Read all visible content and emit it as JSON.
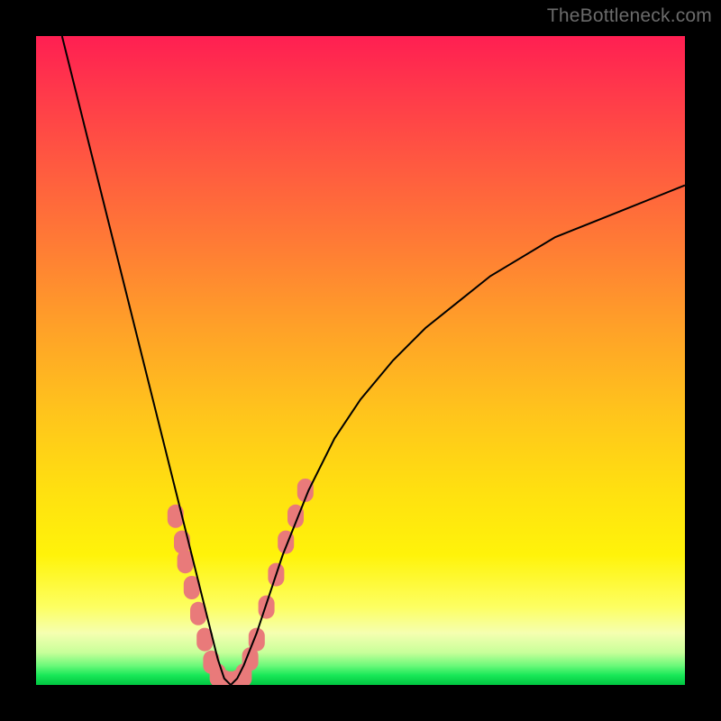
{
  "watermark": {
    "text": "TheBottleneck.com"
  },
  "chart_data": {
    "type": "line",
    "title": "",
    "xlabel": "",
    "ylabel": "",
    "xlim": [
      0,
      100
    ],
    "ylim": [
      0,
      100
    ],
    "grid": false,
    "legend": false,
    "series": [
      {
        "name": "bottleneck-curve",
        "x": [
          4,
          6,
          8,
          10,
          12,
          14,
          16,
          18,
          20,
          22,
          24,
          26,
          27,
          28,
          29,
          30,
          31,
          32,
          34,
          36,
          38,
          42,
          46,
          50,
          55,
          60,
          65,
          70,
          75,
          80,
          85,
          90,
          95,
          100
        ],
        "y": [
          100,
          92,
          84,
          76,
          68,
          60,
          52,
          44,
          36,
          28,
          20,
          12,
          8,
          4,
          1,
          0,
          1,
          3,
          8,
          14,
          20,
          30,
          38,
          44,
          50,
          55,
          59,
          63,
          66,
          69,
          71,
          73,
          75,
          77
        ],
        "color": "#000000",
        "width": 2
      }
    ],
    "markers": {
      "name": "emphasis-pills",
      "color": "#e97a7a",
      "shape": "rounded-rect",
      "points": [
        {
          "x": 21.5,
          "y": 26
        },
        {
          "x": 22.5,
          "y": 22
        },
        {
          "x": 23.0,
          "y": 19
        },
        {
          "x": 24.0,
          "y": 15
        },
        {
          "x": 25.0,
          "y": 11
        },
        {
          "x": 26.0,
          "y": 7
        },
        {
          "x": 27.0,
          "y": 3.5
        },
        {
          "x": 28.0,
          "y": 1.5
        },
        {
          "x": 29.0,
          "y": 0.5
        },
        {
          "x": 30.0,
          "y": 0.3
        },
        {
          "x": 31.0,
          "y": 0.5
        },
        {
          "x": 32.0,
          "y": 1.5
        },
        {
          "x": 33.0,
          "y": 4
        },
        {
          "x": 34.0,
          "y": 7
        },
        {
          "x": 35.5,
          "y": 12
        },
        {
          "x": 37.0,
          "y": 17
        },
        {
          "x": 38.5,
          "y": 22
        },
        {
          "x": 40.0,
          "y": 26
        },
        {
          "x": 41.5,
          "y": 30
        }
      ]
    },
    "background_gradient_stops": [
      {
        "pos": 0.0,
        "color": "#ff1f52"
      },
      {
        "pos": 0.45,
        "color": "#ffa128"
      },
      {
        "pos": 0.8,
        "color": "#fff30a"
      },
      {
        "pos": 0.95,
        "color": "#c8ff9a"
      },
      {
        "pos": 1.0,
        "color": "#00c540"
      }
    ]
  }
}
